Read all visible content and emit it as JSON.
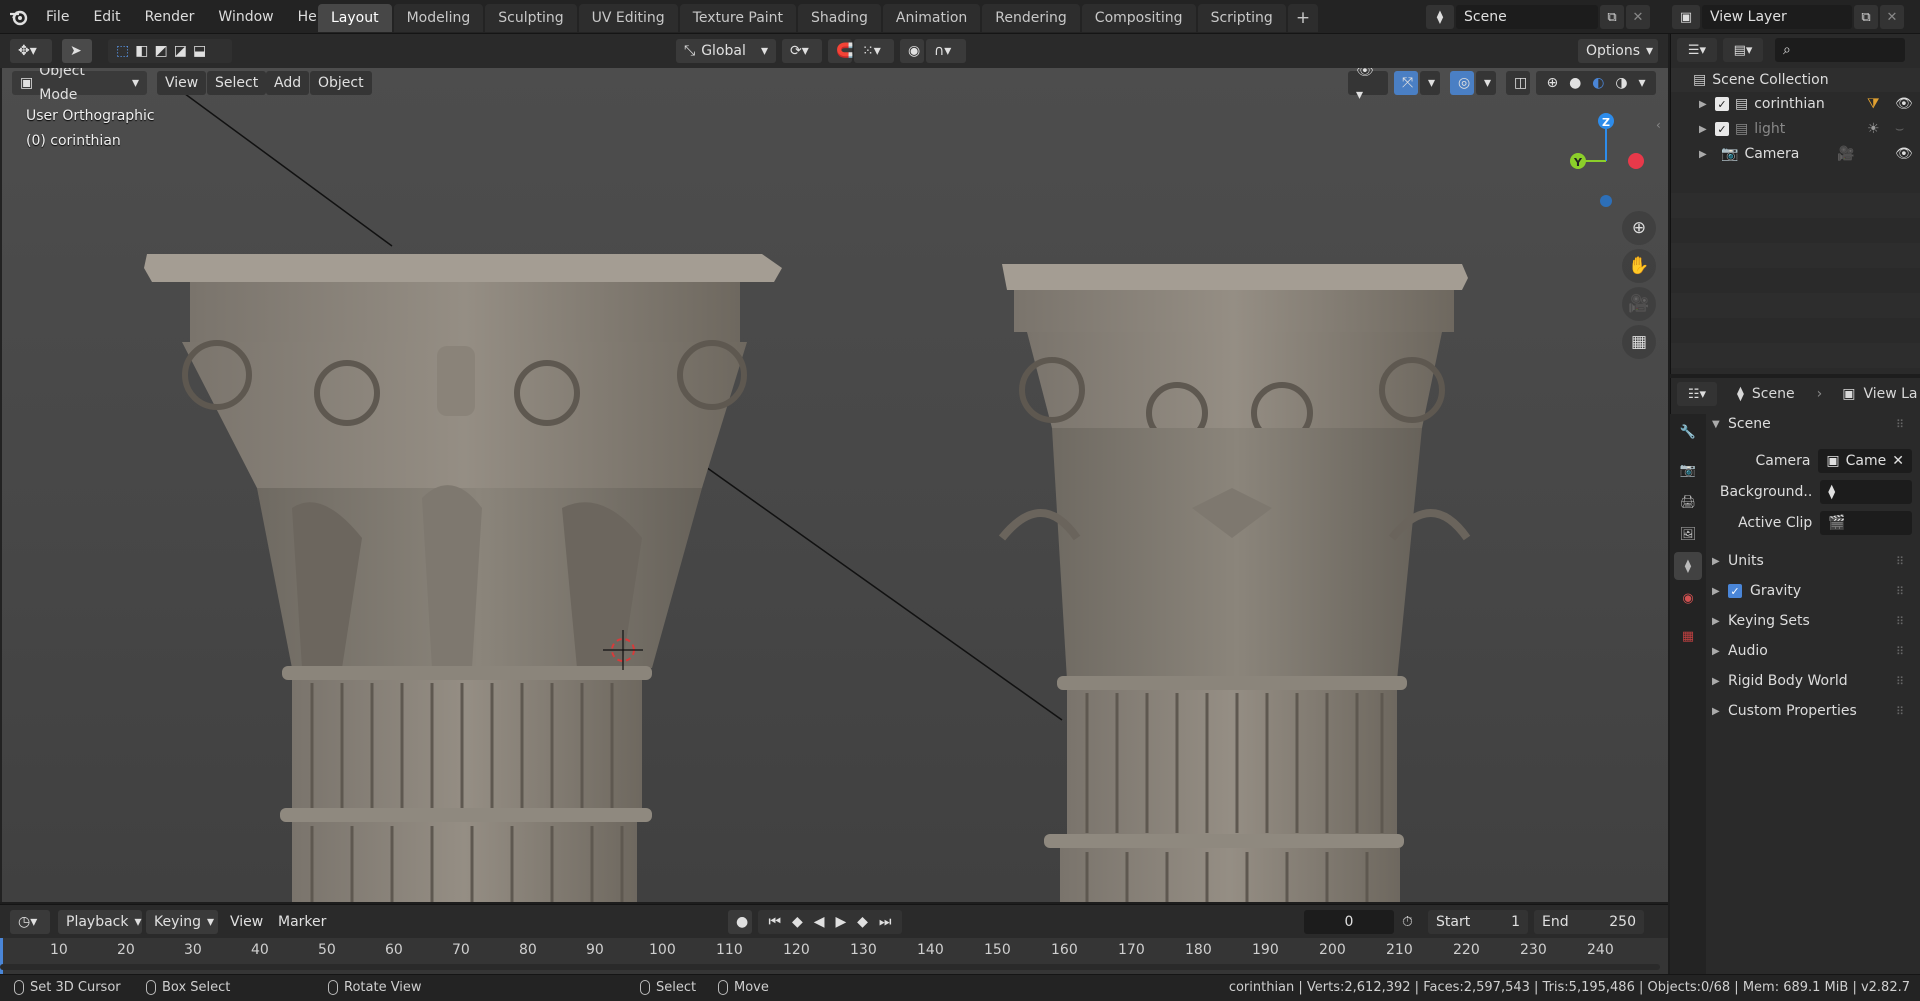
{
  "topbar": {
    "menus": [
      "File",
      "Edit",
      "Render",
      "Window",
      "Help"
    ],
    "workspaces": [
      "Layout",
      "Modeling",
      "Sculpting",
      "UV Editing",
      "Texture Paint",
      "Shading",
      "Animation",
      "Rendering",
      "Compositing",
      "Scripting"
    ],
    "active_workspace": "Layout",
    "scene_name": "Scene",
    "view_layer": "View Layer"
  },
  "viewport_header": {
    "transform_orientation": "Global",
    "options_label": "Options",
    "mode": "Object Mode",
    "menus": [
      "View",
      "Select",
      "Add",
      "Object"
    ]
  },
  "viewport": {
    "view_name": "User Orthographic",
    "object_label": "(0) corinthian",
    "gizmo": {
      "x": "X",
      "y": "Y",
      "z": "Z"
    }
  },
  "outliner": {
    "root": "Scene Collection",
    "items": [
      {
        "name": "corinthian",
        "checked": true,
        "visible": true
      },
      {
        "name": "light",
        "checked": true,
        "visible": false
      },
      {
        "name": "Camera",
        "checked": null,
        "visible": true
      }
    ]
  },
  "properties": {
    "breadcrumb_scene": "Scene",
    "breadcrumb_view": "View La",
    "panel_title": "Scene",
    "fields": [
      {
        "label": "Camera",
        "value": "Came"
      },
      {
        "label": "Background..",
        "value": ""
      },
      {
        "label": "Active Clip",
        "value": ""
      }
    ],
    "subpanels": [
      "Units",
      "Gravity",
      "Keying Sets",
      "Audio",
      "Rigid Body World",
      "Custom Properties"
    ],
    "gravity_checked": true
  },
  "timeline": {
    "menus": [
      "Playback",
      "Keying",
      "View",
      "Marker"
    ],
    "current_frame": "0",
    "start_label": "Start",
    "start": "1",
    "end_label": "End",
    "end": "250",
    "ticks": [
      "10",
      "20",
      "30",
      "40",
      "50",
      "60",
      "70",
      "80",
      "90",
      "100",
      "110",
      "120",
      "130",
      "140",
      "150",
      "160",
      "170",
      "180",
      "190",
      "200",
      "210",
      "220",
      "230",
      "240"
    ]
  },
  "statusbar": {
    "hints": [
      "Set 3D Cursor",
      "Box Select",
      "Rotate View",
      "Select",
      "Move"
    ],
    "stats": "corinthian | Verts:2,612,392 | Faces:2,597,543 | Tris:5,195,486 | Objects:0/68 | Mem: 689.1 MiB | v2.82.7"
  },
  "colors": {
    "x_axis": "#e8394a",
    "y_axis": "#8bcf2a",
    "z_axis": "#2d8ceb",
    "active_tab": "#474747"
  }
}
